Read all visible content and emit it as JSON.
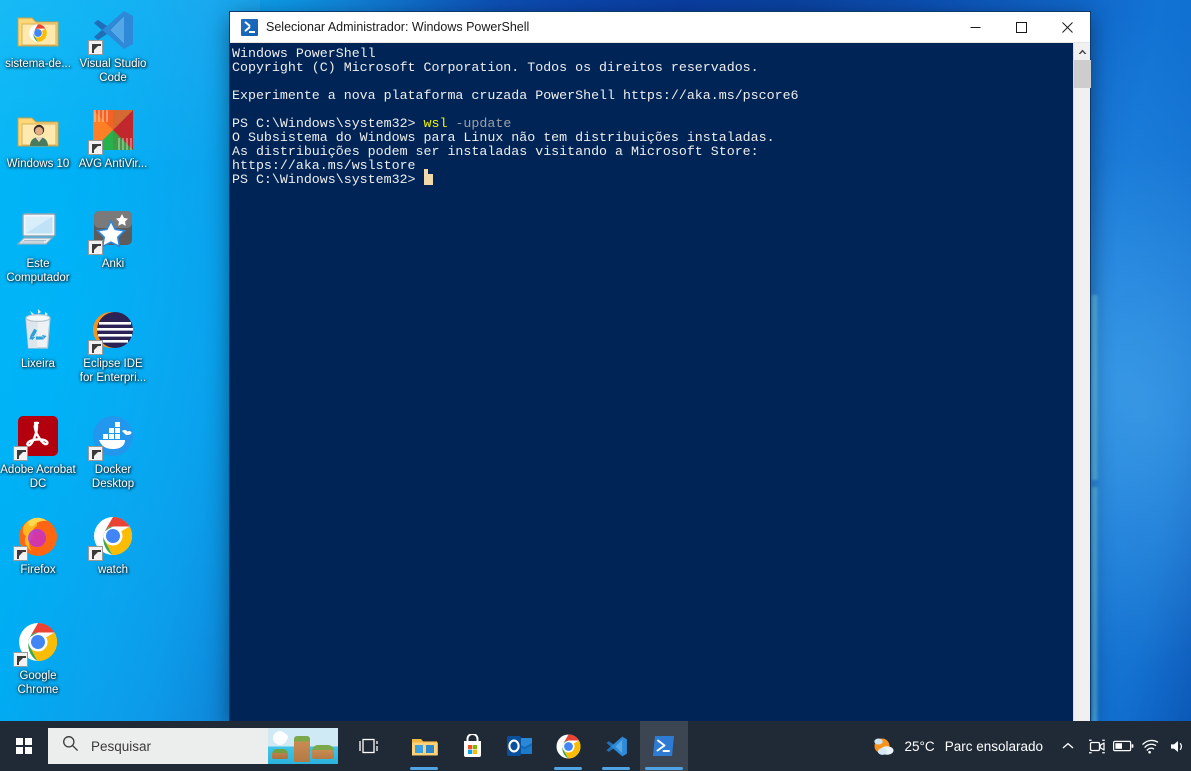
{
  "desktop": {
    "icons": [
      {
        "label": "sistema-de...",
        "icon": "folder-chrome-icon"
      },
      {
        "label": "Visual Studio Code",
        "icon": "vscode-icon"
      },
      {
        "label": "Windows 10",
        "icon": "folder-user-icon"
      },
      {
        "label": "AVG AntiVir...",
        "icon": "avg-antivirus-icon"
      },
      {
        "label": "Este Computador",
        "icon": "this-pc-icon"
      },
      {
        "label": "Anki",
        "icon": "anki-icon"
      },
      {
        "label": "Lixeira",
        "icon": "recycle-bin-icon"
      },
      {
        "label": "Eclipse IDE for Enterpri...",
        "icon": "eclipse-ide-icon"
      },
      {
        "label": "Adobe Acrobat DC",
        "icon": "adobe-acrobat-icon"
      },
      {
        "label": "Docker Desktop",
        "icon": "docker-icon"
      },
      {
        "label": "Firefox",
        "icon": "firefox-icon"
      },
      {
        "label": "watch",
        "icon": "chrome-icon"
      },
      {
        "label": "Google Chrome",
        "icon": "chrome-icon"
      }
    ]
  },
  "window": {
    "title": "Selecionar Administrador: Windows PowerShell",
    "icon": "powershell-icon",
    "minimize_label": "—",
    "maximize_label": "□",
    "close_label": "✕",
    "console": {
      "lines": [
        [
          {
            "t": "Windows PowerShell",
            "c": "white"
          }
        ],
        [
          {
            "t": "Copyright (C) Microsoft Corporation. Todos os direitos reservados.",
            "c": "white"
          }
        ],
        [
          {
            "t": "",
            "c": "white"
          }
        ],
        [
          {
            "t": "Experimente a nova plataforma cruzada PowerShell https://aka.ms/pscore6",
            "c": "white"
          }
        ],
        [
          {
            "t": "",
            "c": "white"
          }
        ],
        [
          {
            "t": "PS C:\\Windows\\system32> ",
            "c": "white"
          },
          {
            "t": "wsl",
            "c": "yellow"
          },
          {
            "t": " ",
            "c": "white"
          },
          {
            "t": "-update",
            "c": "dim"
          }
        ],
        [
          {
            "t": "O Subsistema do Windows para Linux não tem distribuições instaladas.",
            "c": "white"
          }
        ],
        [
          {
            "t": "As distribuições podem ser instaladas visitando a Microsoft Store:",
            "c": "white"
          }
        ],
        [
          {
            "t": "https://aka.ms/wslstore",
            "c": "white"
          }
        ],
        [
          {
            "t": "PS C:\\Windows\\system32> ",
            "c": "white"
          },
          {
            "t": "__CURSOR__",
            "c": "cursor"
          }
        ]
      ]
    },
    "scrollbar": {
      "up_arrow": "▲",
      "down_arrow": "▼"
    }
  },
  "taskbar": {
    "start_label": "Iniciar",
    "search": {
      "placeholder": "Pesquisar",
      "icon": "search-icon"
    },
    "task_view_label": "Visualização de Tarefas",
    "apps": [
      {
        "name": "file-explorer",
        "label": "Explorador de Arquivos",
        "running": true,
        "active": false
      },
      {
        "name": "microsoft-store",
        "label": "Microsoft Store",
        "running": false,
        "active": false
      },
      {
        "name": "outlook",
        "label": "Outlook",
        "running": false,
        "active": false
      },
      {
        "name": "google-chrome",
        "label": "Google Chrome",
        "running": true,
        "active": false
      },
      {
        "name": "vs-code",
        "label": "Visual Studio Code",
        "running": true,
        "active": false
      },
      {
        "name": "windows-powershell",
        "label": "Windows PowerShell",
        "running": true,
        "active": true
      }
    ],
    "tray": {
      "weather": {
        "temperature": "25°C",
        "condition": "Parc ensolarado",
        "icon": "partly-sunny-icon"
      },
      "chevron_label": "Mostrar ícones ocultos",
      "icons": [
        {
          "name": "meet-now-icon",
          "label": "Reunir-se agora"
        },
        {
          "name": "battery-icon",
          "label": "Bateria"
        },
        {
          "name": "wifi-icon",
          "label": "Rede sem fio"
        },
        {
          "name": "volume-icon",
          "label": "Volume"
        }
      ]
    }
  },
  "colors": {
    "console_bg": "#012456",
    "console_fg": "#eeeeee",
    "command_yellow": "#f3f300",
    "param_dim": "#9aa0a6",
    "cursor": "#f2d9ac",
    "taskbar_bg": "#1f2a36",
    "accent": "#4fa3e3",
    "titlebar_bg": "#ffffff"
  }
}
